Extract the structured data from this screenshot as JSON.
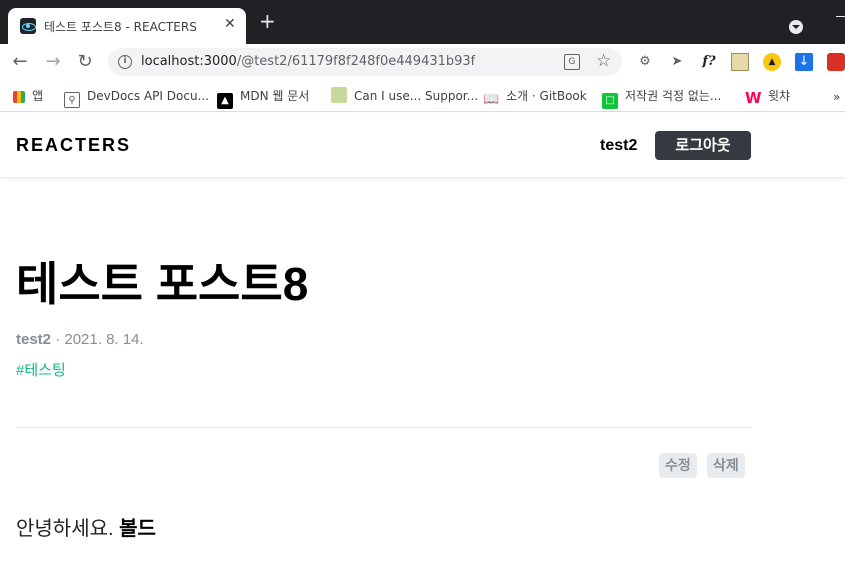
{
  "browser": {
    "tab_title": "테스트 포스트8 - REACTERS",
    "tab_close": "✕",
    "new_tab": "+",
    "url_host": "localhost:3000",
    "url_path": "/@test2/61179f8f248f0e449431b93f",
    "extensions": [
      "settings-ext",
      "cursor-ext",
      "fquestion-ext",
      "image-ext",
      "sort-ext",
      "download-ext",
      "other-ext"
    ],
    "fx_label": "f?"
  },
  "bookmarks": [
    {
      "label": "앱",
      "icon": "apps-grid-icon"
    },
    {
      "label": "DevDocs API Docu...",
      "icon": "devdocs-icon"
    },
    {
      "label": "MDN 웹 문서",
      "icon": "mdn-icon"
    },
    {
      "label": "Can I use... Suppor...",
      "icon": "caniuse-icon"
    },
    {
      "label": "소개 · GitBook",
      "icon": "gitbook-icon"
    },
    {
      "label": "저작권 걱정 없는...",
      "icon": "copyright-icon"
    },
    {
      "label": "윗챠",
      "icon": "watcha-icon"
    }
  ],
  "bookmarks_more": "»",
  "header": {
    "logo": "REACTERS",
    "username": "test2",
    "logout_label": "로그아웃"
  },
  "post": {
    "title": "테스트 포스트8",
    "author": "test2",
    "separator": " · ",
    "date": "2021. 8. 14.",
    "tag": "#테스팅",
    "edit_label": "수정",
    "delete_label": "삭제",
    "body_plain": "안녕하세요. ",
    "body_bold": "볼드"
  },
  "colors": {
    "tab_strip": "#202124",
    "logout_bg": "#343a40",
    "tag": "#12b886",
    "meta": "#868e96"
  }
}
